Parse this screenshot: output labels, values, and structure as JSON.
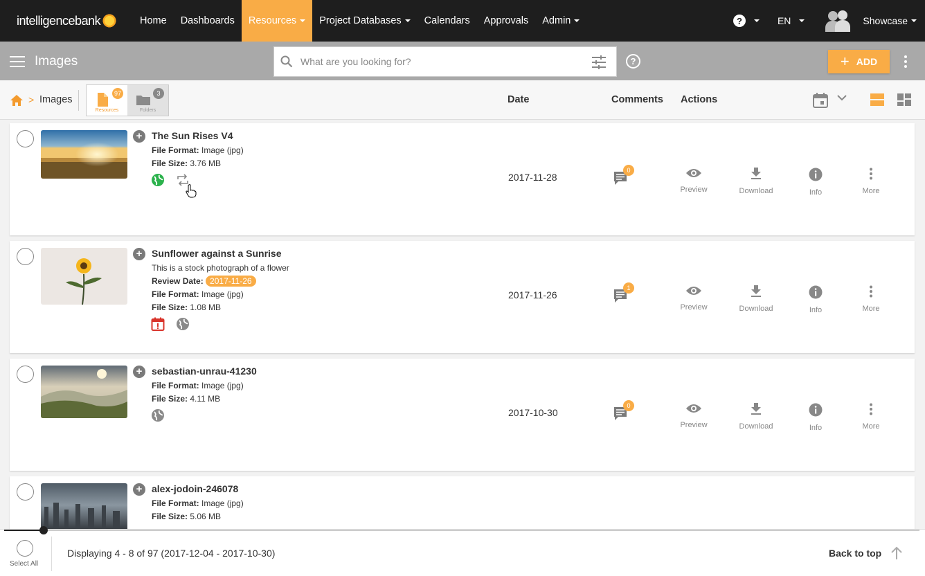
{
  "brand": {
    "logo_text": "intelligencebank"
  },
  "topnav": {
    "items": [
      {
        "label": "Home",
        "dropdown": false
      },
      {
        "label": "Dashboards",
        "dropdown": false
      },
      {
        "label": "Resources",
        "dropdown": true,
        "active": true
      },
      {
        "label": "Project Databases",
        "dropdown": true
      },
      {
        "label": "Calendars",
        "dropdown": false
      },
      {
        "label": "Approvals",
        "dropdown": false
      },
      {
        "label": "Admin",
        "dropdown": true
      }
    ],
    "help_glyph": "?",
    "language": "EN",
    "user": "Showcase"
  },
  "toolbar": {
    "title": "Images",
    "search_placeholder": "What are you looking for?",
    "help_glyph": "?",
    "add_label": "ADD",
    "add_glyph": "+"
  },
  "listhead": {
    "breadcrumb_sep": ">",
    "breadcrumb_current": "Images",
    "resources_label": "Resources",
    "resources_count": "97",
    "folders_label": "Folders",
    "folders_count": "3",
    "col_date": "Date",
    "col_comments": "Comments",
    "col_actions": "Actions"
  },
  "actions": {
    "preview": "Preview",
    "download": "Download",
    "info": "Info",
    "more": "More"
  },
  "labels": {
    "file_format": "File Format:",
    "file_size": "File Size:",
    "review_date": "Review Date:"
  },
  "rows": [
    {
      "title": "The Sun Rises V4",
      "file_format": "Image (jpg)",
      "file_size": "3.76 MB",
      "date": "2017-11-28",
      "comments": "0"
    },
    {
      "title": "Sunflower against a Sunrise",
      "description": "This is a stock photograph of a flower",
      "review_date": "2017-11-26",
      "file_format": "Image (jpg)",
      "file_size": "1.08 MB",
      "date": "2017-11-26",
      "comments": "1"
    },
    {
      "title": "sebastian-unrau-41230",
      "file_format": "Image (jpg)",
      "file_size": "4.11 MB",
      "date": "2017-10-30",
      "comments": "0"
    },
    {
      "title": "alex-jodoin-246078",
      "file_format": "Image (jpg)",
      "file_size": "5.06 MB"
    }
  ],
  "footer": {
    "select_all": "Select All",
    "displaying": "Displaying 4 - 8 of 97 (2017-12-04 - 2017-10-30)",
    "back_to_top": "Back to top",
    "scroll_progress": 0.043
  },
  "colors": {
    "accent": "#f9ac46",
    "nav_bg": "#1e1e1e",
    "toolbar_bg": "#a9a9a9",
    "globe_green": "#2bb24c",
    "alert_red": "#d9342b"
  }
}
